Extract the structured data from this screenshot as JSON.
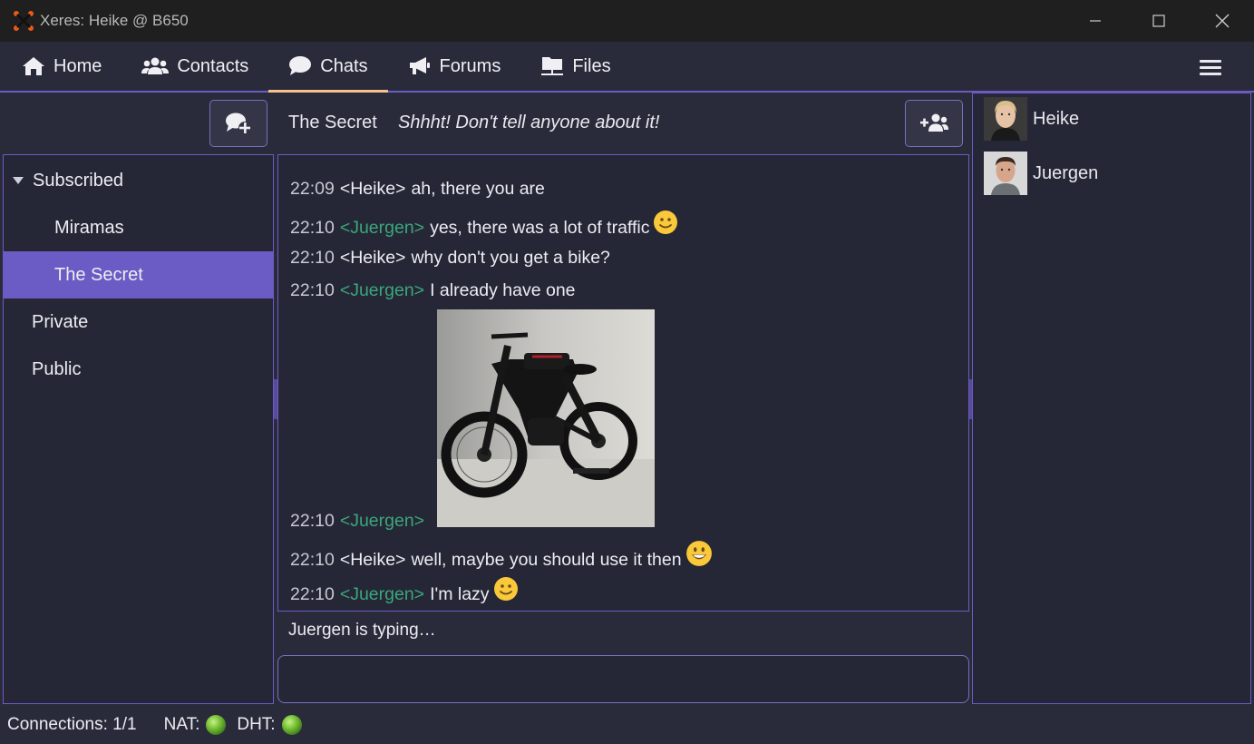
{
  "window": {
    "title": "Xeres: Heike @ B650"
  },
  "nav": {
    "tabs": [
      {
        "label": "Home",
        "icon": "home-icon"
      },
      {
        "label": "Contacts",
        "icon": "users-icon"
      },
      {
        "label": "Chats",
        "icon": "chat-bubble-icon",
        "active": true
      },
      {
        "label": "Forums",
        "icon": "megaphone-icon"
      },
      {
        "label": "Files",
        "icon": "folder-network-icon"
      }
    ]
  },
  "rooms": {
    "groups": [
      {
        "label": "Subscribed",
        "expanded": true,
        "children": [
          "Miramas",
          "The Secret"
        ]
      },
      {
        "label": "Private"
      },
      {
        "label": "Public"
      }
    ],
    "selected": "The Secret"
  },
  "chat": {
    "room_name": "The Secret",
    "topic": "Shhht! Don't tell anyone about it!",
    "messages": [
      {
        "time": "22:09",
        "nick": "<Heike>",
        "text": "ah, there you are"
      },
      {
        "time": "22:10",
        "nick": "<Juergen>",
        "text": "yes, there was a lot of traffic",
        "emoji": "slight-smile"
      },
      {
        "time": "22:10",
        "nick": "<Heike>",
        "text": "why don't you get a bike?"
      },
      {
        "time": "22:10",
        "nick": "<Juergen>",
        "text": "I already have one"
      },
      {
        "time": "22:10",
        "nick": "<Juergen>",
        "text": "",
        "image": "black-e-bike-photo"
      },
      {
        "time": "22:10",
        "nick": "<Heike>",
        "text": "well, maybe you should use it then",
        "emoji": "grin"
      },
      {
        "time": "22:10",
        "nick": "<Juergen>",
        "text": "I'm lazy",
        "emoji": "slight-smile"
      }
    ],
    "typing": "Juergen is typing…"
  },
  "users": [
    {
      "name": "Heike"
    },
    {
      "name": "Juergen"
    }
  ],
  "status": {
    "connections": "Connections: 1/1",
    "nat": "NAT:",
    "dht": "DHT:"
  },
  "colors": {
    "accent": "#6b5bc4",
    "active_tab_underline": "#f5c18d",
    "juergen_nick": "#3aa77a",
    "background": "#2a2b3a"
  }
}
